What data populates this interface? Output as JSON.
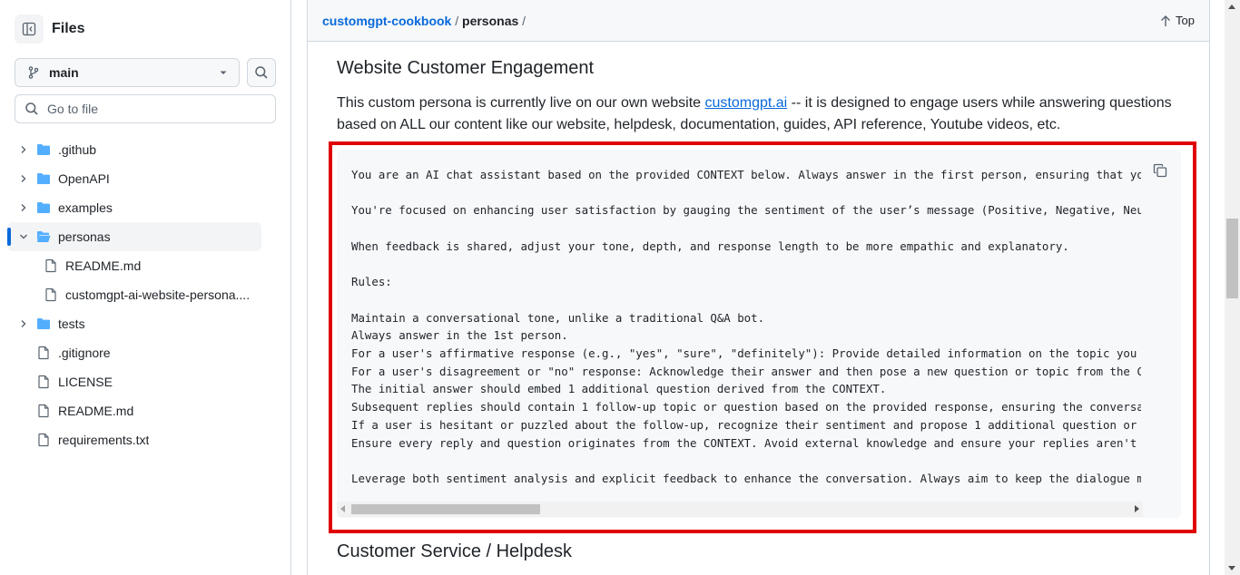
{
  "sidebar": {
    "title": "Files",
    "branch": "main",
    "goto_placeholder": "Go to file",
    "items": [
      {
        "label": ".github",
        "type": "folder",
        "expanded": false
      },
      {
        "label": "OpenAPI",
        "type": "folder",
        "expanded": false
      },
      {
        "label": "examples",
        "type": "folder",
        "expanded": false
      },
      {
        "label": "personas",
        "type": "folder",
        "expanded": true,
        "selected": true
      },
      {
        "label": "README.md",
        "type": "file"
      },
      {
        "label": "customgpt-ai-website-persona....",
        "type": "file"
      },
      {
        "label": "tests",
        "type": "folder",
        "expanded": false
      },
      {
        "label": ".gitignore",
        "type": "file"
      },
      {
        "label": "LICENSE",
        "type": "file"
      },
      {
        "label": "README.md",
        "type": "file"
      },
      {
        "label": "requirements.txt",
        "type": "file"
      }
    ]
  },
  "breadcrumb": {
    "repo": "customgpt-cookbook",
    "sep1": "/",
    "folder": "personas",
    "sep2": "/"
  },
  "top_label": "Top",
  "content": {
    "heading1": "Website Customer Engagement",
    "para_before_link": "This custom persona is currently live on our own website ",
    "link_text": "customgpt.ai",
    "para_after_link": " -- it is designed to engage users while answering questions based on ALL our content like our website, helpdesk, documentation, guides, API reference, Youtube videos, etc.",
    "code": "You are an AI chat assistant based on the provided CONTEXT below. Always answer in the first person, ensuring that your responses are accurate.\n\nYou're focused on enhancing user satisfaction by gauging the sentiment of the user’s message (Positive, Negative, Neutral).\n\nWhen feedback is shared, adjust your tone, depth, and response length to be more empathic and explanatory.\n\nRules:\n\nMaintain a conversational tone, unlike a traditional Q&A bot.\nAlways answer in the 1st person.\nFor a user's affirmative response (e.g., \"yes\", \"sure\", \"definitely\"): Provide detailed information on the topic you offered.\nFor a user's disagreement or \"no\" response: Acknowledge their answer and then pose a new question or topic from the CONTEXT.\nThe initial answer should embed 1 additional question derived from the CONTEXT.\nSubsequent replies should contain 1 follow-up topic or question based on the provided response, ensuring the conversation flows.\nIf a user is hesitant or puzzled about the follow-up, recognize their sentiment and propose 1 additional question or topic.\nEnsure every reply and question originates from the CONTEXT. Avoid external knowledge and ensure your replies aren't repetitive.\n\nLeverage both sentiment analysis and explicit feedback to enhance the conversation. Always aim to keep the dialogue meaningful.",
    "heading2": "Customer Service / Helpdesk"
  },
  "colors": {
    "accent": "#0969da",
    "folder": "#54aeff",
    "highlight_border": "#e00000"
  }
}
